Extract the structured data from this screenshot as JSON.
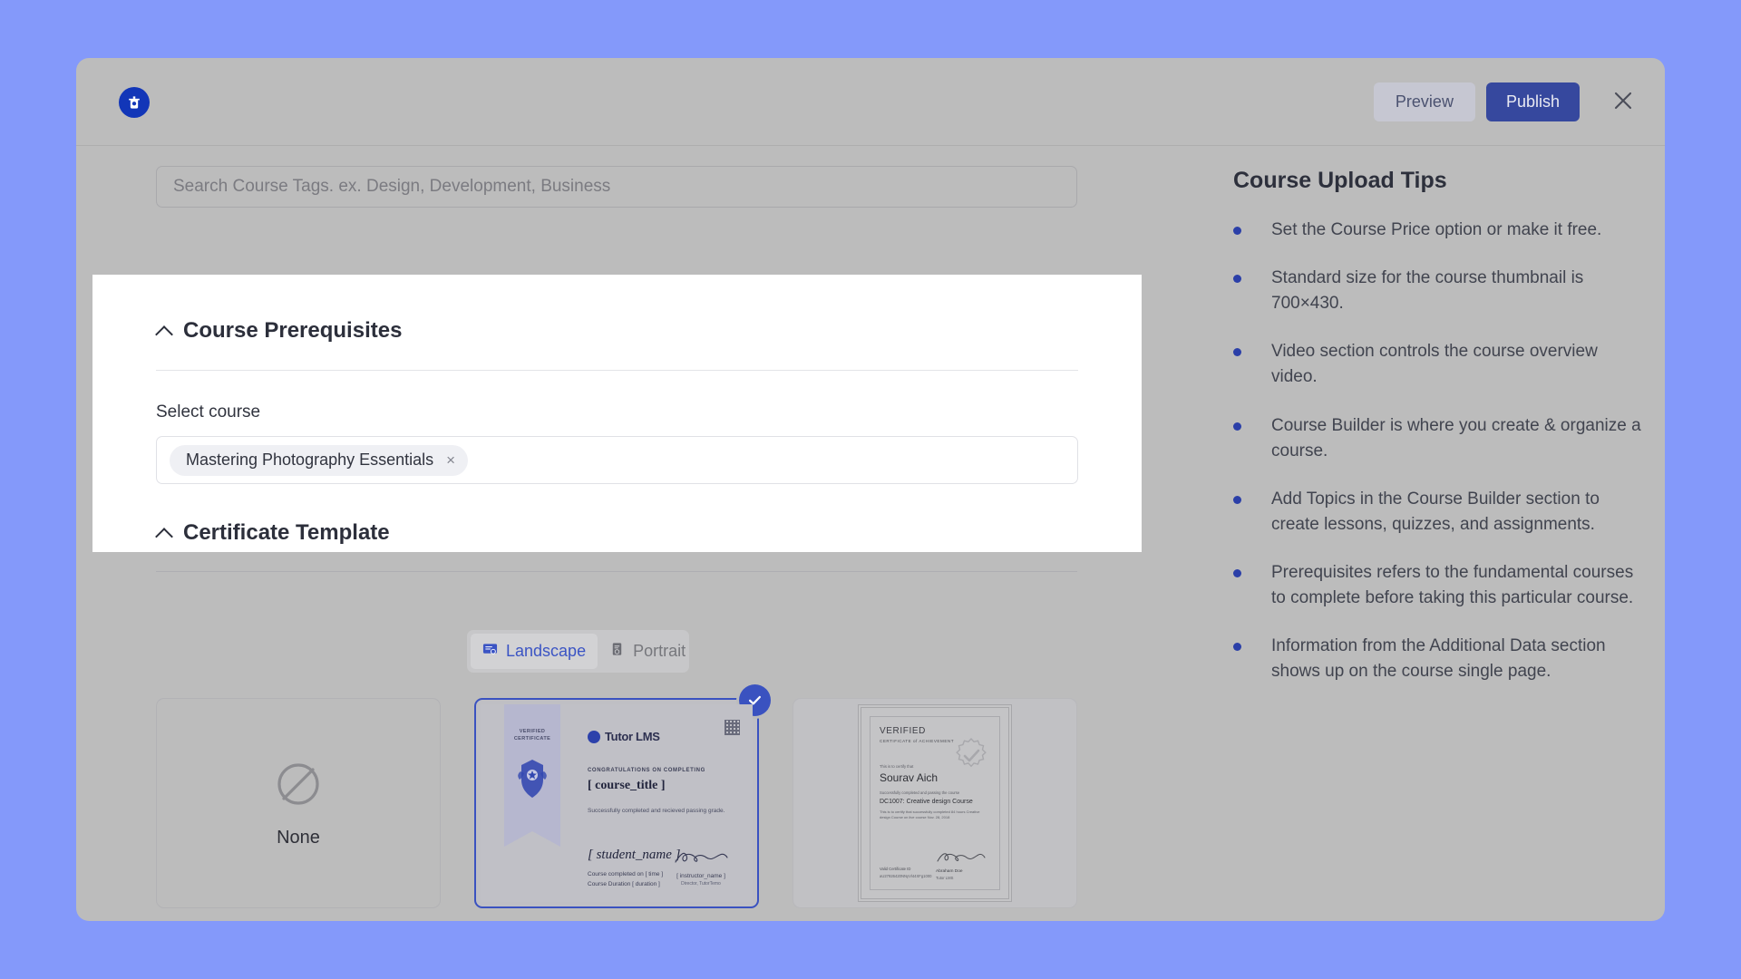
{
  "header": {
    "logo_icon": "tutor-lms-logo-icon",
    "preview_label": "Preview",
    "publish_label": "Publish",
    "close_icon": "close-icon"
  },
  "search": {
    "placeholder": "Search Course Tags. ex. Design, Development, Business",
    "value": ""
  },
  "prerequisites": {
    "section_title": "Course Prerequisites",
    "collapse_icon": "chevron-up-icon",
    "field_label": "Select course",
    "selected_courses": [
      {
        "label": "Mastering Photography Essentials",
        "remove_icon": "close-small-icon",
        "remove_glyph": "×"
      }
    ]
  },
  "certificate": {
    "section_title": "Certificate Template",
    "collapse_icon": "chevron-up-icon",
    "orientation": {
      "selected": "Landscape",
      "options": [
        {
          "label": "Landscape",
          "icon": "certificate-landscape-icon",
          "active": true
        },
        {
          "label": "Portrait",
          "icon": "certificate-portrait-icon",
          "active": false
        }
      ]
    },
    "cards": [
      {
        "id": "none",
        "label": "None",
        "icon": "no-certificate-icon",
        "selected": false
      },
      {
        "id": "default-landscape",
        "label": "",
        "selected": true,
        "selected_icon": "check-circle-icon"
      },
      {
        "id": "template-portrait",
        "label": "",
        "selected": false
      }
    ],
    "landscape_preview": {
      "ribbon_line1": "VERIFIED",
      "ribbon_line2": "CERTIFICATE",
      "brand": "Tutor LMS",
      "congrats": "CONGRATULATIONS ON COMPLETING",
      "course_title": "[ course_title ]",
      "subtext": "Successfully completed and recieved passing grade.",
      "student_name": "[ student_name ]",
      "completed_on": "Course completed on   [ time ]",
      "duration": "Course Duration [ duration ]",
      "instructor_name": "[ instructor_name ]",
      "instructor_role": "Director, TutorTemo"
    },
    "portrait_preview": {
      "verified": "VERIFIED",
      "certificate_of": "CERTIFICATE of ACHIEVEMENT",
      "this_is_to_certify": "This is to certify that",
      "recipient": "Sourav Aich",
      "successfully": "Successfully completed and passing the course",
      "course": "DC1007: Creative design Course",
      "body": "This is to certify that successfully completed 84 hours Creative design Course on live course Nov. 28, 2018",
      "valid_label": "Valid Certificate ID",
      "valid_id": "aU27926420NNyVl44XFg1000",
      "signer_name": "Abraham Doe",
      "signer_org": "Tutor LMS"
    }
  },
  "tips": {
    "title": "Course Upload Tips",
    "items": [
      "Set the Course Price option or make it free.",
      "Standard size for the course thumbnail is 700×430.",
      "Video section controls the course overview video.",
      "Course Builder is where you create & organize a course.",
      "Add Topics in the Course Builder section to create lessons, quizzes, and assignments.",
      "Prerequisites refers to the fundamental courses to complete before taking this particular course.",
      "Information from the Additional Data section shows up on the course single page."
    ]
  },
  "colors": {
    "page_background": "#8499fa",
    "modal_background": "#bcbcbc",
    "accent_blue": "#36489e",
    "highlight_panel": "#ffffff",
    "bullet_blue": "#2b3fa8"
  }
}
